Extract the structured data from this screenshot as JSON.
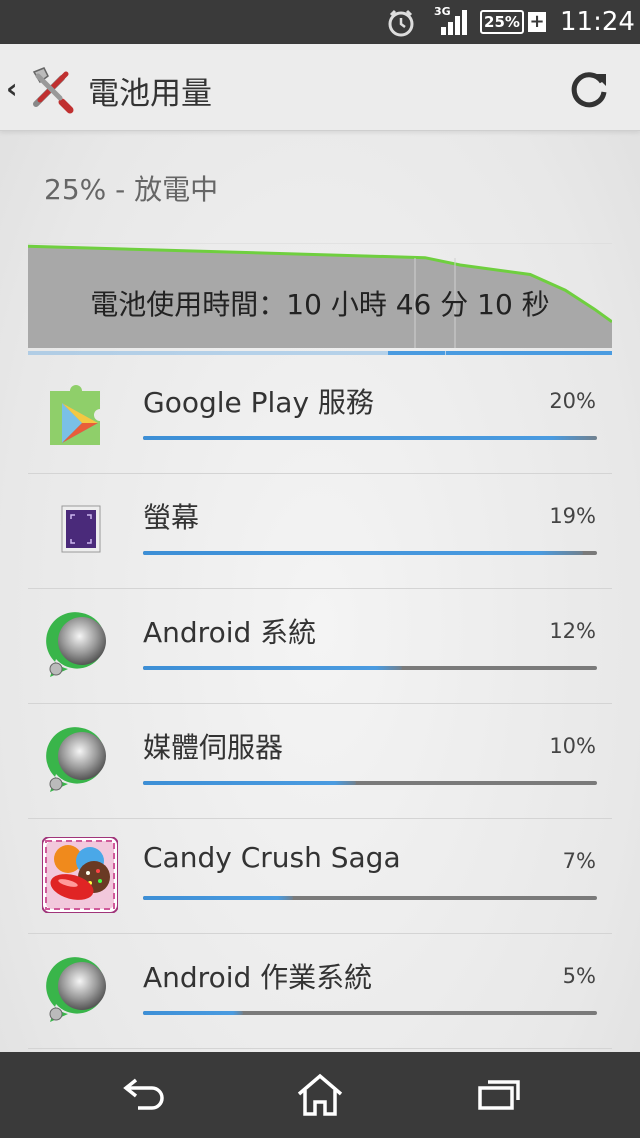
{
  "status_bar": {
    "network_type": "3G",
    "battery_percent": "25%",
    "battery_charging_symbol": "+",
    "time": "11:24",
    "icons": [
      "alarm-clock-icon",
      "signal-icon",
      "battery-icon"
    ]
  },
  "action_bar": {
    "title": "電池用量",
    "back_icon": "chevron-left-icon",
    "app_icon": "settings-tools-icon",
    "refresh_icon": "refresh-icon"
  },
  "summary": {
    "status": "25% - 放電中"
  },
  "graph": {
    "caption": "電池使用時間：10 小時 46 分 10 秒",
    "line_color": "#6fcf3f",
    "fill_color": "#a8a8a8",
    "end_color": "#f0a030",
    "level_points": [
      [
        0,
        0.97
      ],
      [
        0.68,
        0.86
      ],
      [
        0.74,
        0.79
      ],
      [
        0.86,
        0.7
      ],
      [
        0.92,
        0.55
      ],
      [
        0.97,
        0.37
      ],
      [
        1.0,
        0.25
      ]
    ]
  },
  "usage_list": [
    {
      "name": "Google Play 服務",
      "percent": "20%",
      "level": 1.0,
      "icon": "google-play-services-icon"
    },
    {
      "name": "螢幕",
      "percent": "19%",
      "level": 0.97,
      "icon": "screen-icon"
    },
    {
      "name": "Android 系統",
      "percent": "12%",
      "level": 0.57,
      "icon": "android-system-icon"
    },
    {
      "name": "媒體伺服器",
      "percent": "10%",
      "level": 0.47,
      "icon": "media-server-icon"
    },
    {
      "name": "Candy Crush Saga",
      "percent": "7%",
      "level": 0.33,
      "icon": "candy-crush-icon"
    },
    {
      "name": "Android 作業系統",
      "percent": "5%",
      "level": 0.22,
      "icon": "android-os-icon"
    }
  ],
  "nav_bar": {
    "buttons": [
      "back-icon",
      "home-icon",
      "recent-apps-icon"
    ]
  },
  "colors": {
    "bar_fill": "#4a9be0",
    "bar_track": "#7a7a7a",
    "status_bar_bg": "#3a3a3a"
  }
}
